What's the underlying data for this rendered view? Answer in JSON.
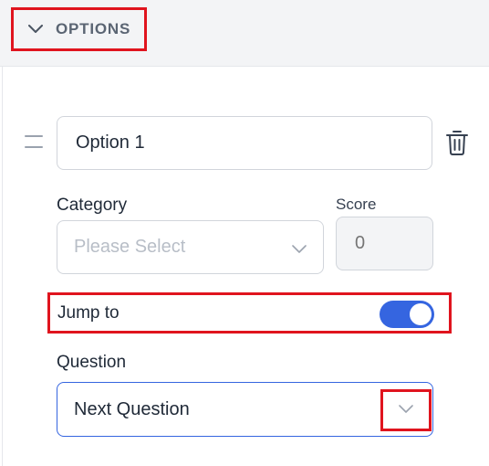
{
  "options_section": {
    "toggle_label": "OPTIONS",
    "chevron_icon": "chevron-down-icon"
  },
  "option": {
    "drag_icon": "drag-handle-icon",
    "value": "Option 1",
    "delete_icon": "trash-icon"
  },
  "category": {
    "label": "Category",
    "placeholder": "Please Select",
    "chevron_icon": "chevron-down-icon"
  },
  "score": {
    "label": "Score",
    "value": "0"
  },
  "jump_to": {
    "label": "Jump to",
    "enabled": true
  },
  "question": {
    "label": "Question",
    "selected": "Next Question",
    "chevron_icon": "chevron-down-icon"
  },
  "colors": {
    "accent": "#3565e0",
    "highlight": "#e0141e",
    "header_bg": "#f3f4f6"
  }
}
